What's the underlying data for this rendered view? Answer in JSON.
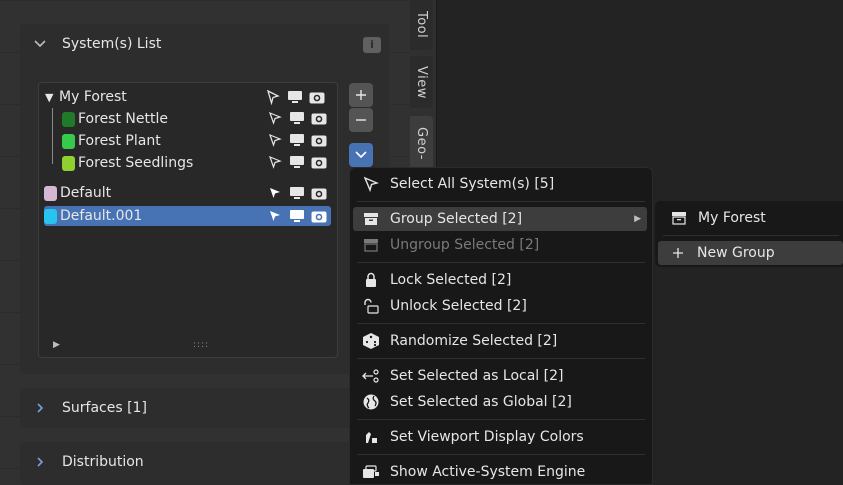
{
  "panels": {
    "systems_list": {
      "title": "System(s) List"
    },
    "surfaces": {
      "title": "Surfaces [1]"
    },
    "distribution": {
      "title": "Distribution"
    }
  },
  "systems": [
    {
      "label": "My Forest",
      "color": "",
      "kind": "group"
    },
    {
      "label": "Forest Nettle",
      "color": "#1f7a2a",
      "kind": "child"
    },
    {
      "label": "Forest Plant",
      "color": "#36c94a",
      "kind": "child"
    },
    {
      "label": "Forest Seedlings",
      "color": "#8fd12f",
      "kind": "child"
    },
    {
      "label": "Default",
      "color": "#d6b7d3",
      "kind": "item"
    },
    {
      "label": "Default.001",
      "color": "#27c4f0",
      "kind": "item",
      "selected": true
    }
  ],
  "tabs": [
    "Tool",
    "View",
    "Geo-"
  ],
  "menu": {
    "items": [
      {
        "label": "Select All System(s) [5]",
        "icon": "cursor-icon"
      },
      {
        "label": "Group Selected [2]",
        "icon": "box-icon",
        "highlight": true,
        "submenu": true
      },
      {
        "label": "Ungroup Selected [2]",
        "icon": "box-open-icon",
        "disabled": true
      },
      {
        "label": "Lock Selected [2]",
        "icon": "lock-icon"
      },
      {
        "label": "Unlock Selected [2]",
        "icon": "unlock-icon"
      },
      {
        "label": "Randomize Selected [2]",
        "icon": "dice-icon"
      },
      {
        "label": "Set Selected as Local [2]",
        "icon": "local-icon"
      },
      {
        "label": "Set Selected as Global [2]",
        "icon": "globe-icon"
      },
      {
        "label": "Set Viewport Display Colors",
        "icon": "color-icon"
      },
      {
        "label": "Show Active-System Engine",
        "icon": "engine-icon"
      }
    ]
  },
  "submenu": {
    "items": [
      {
        "label": "My Forest",
        "icon": "box-icon"
      },
      {
        "label": "New Group",
        "icon": "plus-icon",
        "highlight": true
      }
    ]
  }
}
